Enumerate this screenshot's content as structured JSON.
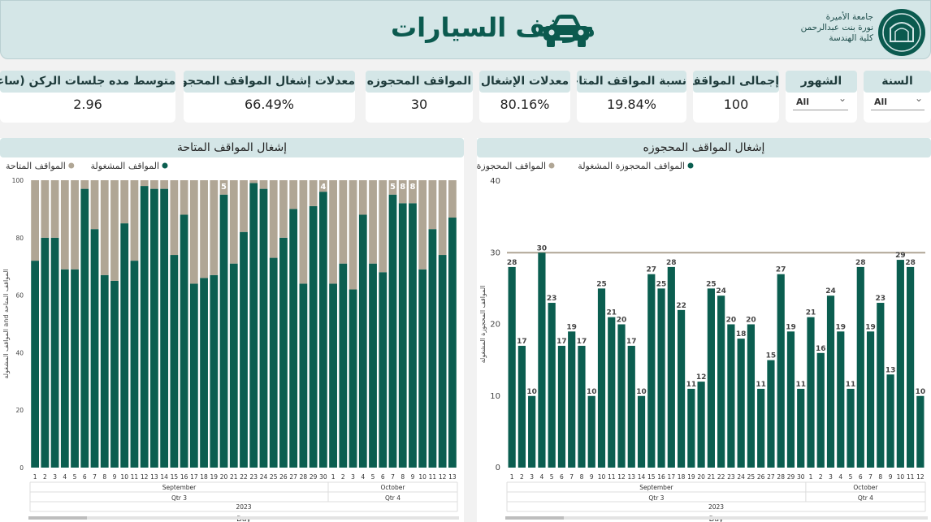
{
  "header": {
    "title": "موقف السيارات",
    "university_lines": [
      "جامعة الأميرة",
      "نورة بنت عبدالرحمن",
      "كلية الهندسة"
    ]
  },
  "filters": {
    "year": {
      "label": "السنة",
      "value": "All"
    },
    "months": {
      "label": "الشهور",
      "value": "All"
    }
  },
  "kpis": [
    {
      "label": "إجمالى المواقف",
      "value": "100"
    },
    {
      "label": "نسبة المواقف المتاحة",
      "value": "19.84%"
    },
    {
      "label": "معدلات الإشغال",
      "value": "80.16%"
    },
    {
      "label": "المواقف المحجوزه",
      "value": "30"
    },
    {
      "label": "معدلات إشغال المواقف المحجوزه",
      "value": "66.49%"
    },
    {
      "label": "متوسط مده جلسات الركن (ساعات)",
      "value": "2.96"
    }
  ],
  "colors": {
    "occupied": "#0b5e50",
    "available": "#b0a695",
    "accent": "#0b5a4f"
  },
  "chart_data": [
    {
      "type": "bar",
      "title": "إشغال المواقف المتاحة",
      "stacked": true,
      "legend": [
        "المواقف المشغولة",
        "المواقف المتاحة"
      ],
      "ylabel": "المواقف المشغولة and المواقف المتاحة",
      "xlabel": "Day",
      "ylim": [
        0,
        100
      ],
      "yticks": [
        0,
        20,
        40,
        60,
        80,
        100
      ],
      "categories": [
        "1",
        "2",
        "3",
        "4",
        "5",
        "6",
        "7",
        "8",
        "9",
        "10",
        "11",
        "12",
        "13",
        "14",
        "15",
        "16",
        "17",
        "18",
        "19",
        "20",
        "21",
        "22",
        "23",
        "24",
        "25",
        "26",
        "27",
        "28",
        "29",
        "30",
        "1",
        "2",
        "3",
        "4",
        "5",
        "6",
        "7",
        "8",
        "9",
        "10",
        "11",
        "12",
        "13"
      ],
      "groups": [
        {
          "month": "September",
          "quarter": "Qtr 3",
          "count": 30
        },
        {
          "month": "October",
          "quarter": "Qtr 4",
          "count": 13
        }
      ],
      "year": "2023",
      "series": [
        {
          "name": "المواقف المشغولة",
          "values": [
            72,
            80,
            80,
            69,
            69,
            97,
            83,
            67,
            65,
            85,
            72,
            98,
            97,
            97,
            74,
            88,
            64,
            66,
            67,
            95,
            71,
            82,
            99,
            97,
            73,
            80,
            90,
            64,
            91,
            96,
            64,
            71,
            62,
            88,
            71,
            68,
            95,
            92,
            92,
            69,
            83,
            74,
            87
          ]
        },
        {
          "name": "المواقف المتاحة",
          "values": [
            28,
            20,
            20,
            31,
            31,
            3,
            17,
            33,
            35,
            15,
            28,
            2,
            3,
            3,
            26,
            12,
            36,
            34,
            33,
            5,
            29,
            18,
            1,
            3,
            27,
            20,
            10,
            36,
            9,
            4,
            36,
            29,
            38,
            12,
            29,
            32,
            5,
            8,
            8,
            31,
            17,
            26,
            13
          ]
        }
      ],
      "data_labels": [
        {
          "index": 19,
          "text": "5"
        },
        {
          "index": 29,
          "text": "4"
        },
        {
          "index": 36,
          "text": "5"
        },
        {
          "index": 37,
          "text": "8"
        },
        {
          "index": 38,
          "text": "8"
        }
      ]
    },
    {
      "type": "bar",
      "title": "إشغال المواقف المحجوزه",
      "legend": [
        "المواقف المحجوزة المشغولة",
        "المواقف المحجوزة"
      ],
      "ylabel": "المواقف المحجوزة المشغولة",
      "xlabel": "Day",
      "ylim": [
        0,
        40
      ],
      "yticks": [
        0,
        10,
        20,
        30,
        40
      ],
      "reference_line": 30,
      "categories": [
        "1",
        "2",
        "3",
        "4",
        "5",
        "6",
        "7",
        "8",
        "9",
        "10",
        "11",
        "12",
        "13",
        "14",
        "15",
        "16",
        "17",
        "18",
        "19",
        "20",
        "21",
        "22",
        "23",
        "24",
        "25",
        "26",
        "27",
        "28",
        "29",
        "30",
        "1",
        "2",
        "3",
        "4",
        "5",
        "6",
        "7",
        "8",
        "9",
        "10",
        "11",
        "12"
      ],
      "groups": [
        {
          "month": "September",
          "quarter": "Qtr 3",
          "count": 30
        },
        {
          "month": "October",
          "quarter": "Qtr 4",
          "count": 12
        }
      ],
      "year": "2023",
      "series": [
        {
          "name": "المواقف المحجوزة المشغولة",
          "values": [
            28,
            17,
            10,
            30,
            23,
            17,
            19,
            17,
            10,
            25,
            21,
            20,
            17,
            10,
            27,
            25,
            28,
            22,
            11,
            12,
            25,
            24,
            20,
            18,
            20,
            11,
            15,
            27,
            19,
            11,
            21,
            16,
            24,
            19,
            11,
            28,
            19,
            23,
            13,
            29,
            28,
            10
          ]
        }
      ]
    }
  ]
}
